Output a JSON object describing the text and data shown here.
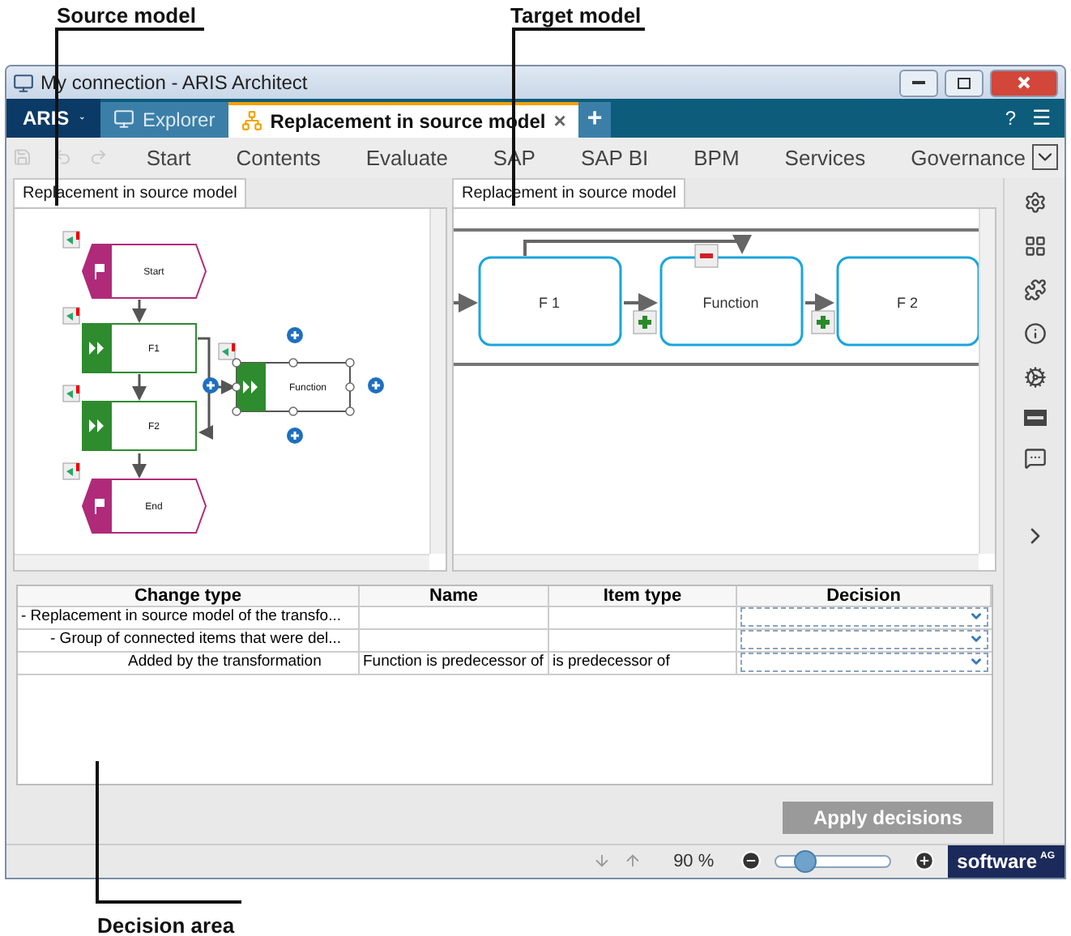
{
  "callouts": [
    {
      "label": "Source model"
    },
    {
      "label": "Target model"
    },
    {
      "label": "Decision area"
    }
  ],
  "window": {
    "title": "My connection - ARIS Architect"
  },
  "app_bar": {
    "menu": "ARIS",
    "tabs": [
      {
        "label": "Explorer",
        "selected": false
      },
      {
        "label": "Replacement in source model",
        "selected": true,
        "close": "×"
      }
    ],
    "new_tab": "+",
    "help": "?",
    "menu_icon": "☰"
  },
  "ribbon": {
    "tabs": [
      "Start",
      "Contents",
      "Evaluate",
      "SAP",
      "SAP BI",
      "BPM",
      "Services",
      "Governance"
    ]
  },
  "source_panel": {
    "tab": "Replacement in source model",
    "nodes": [
      {
        "kind": "event",
        "label": "Start"
      },
      {
        "kind": "function",
        "label": "F1",
        "selected": false
      },
      {
        "kind": "function",
        "label": "F2",
        "selected": false
      },
      {
        "kind": "event",
        "label": "End"
      },
      {
        "kind": "function",
        "label": "Function",
        "selected": true
      }
    ]
  },
  "target_panel": {
    "tab": "Replacement in source model",
    "nodes": [
      {
        "label": "F 1"
      },
      {
        "label": "Function"
      },
      {
        "label": "F 2"
      }
    ]
  },
  "decision_table": {
    "columns": [
      "Change type",
      "Name",
      "Item type",
      "Decision"
    ],
    "rows": [
      {
        "change_type": "- Replacement in source model of the transfo...",
        "children": [
          {
            "change_type": "- Group of connected items that were del...",
            "children": [
              {
                "change_type": "Added by the transformation",
                "name": "Function is predecessor of",
                "item_type": "is predecessor of"
              }
            ]
          }
        ]
      }
    ]
  },
  "apply_button": {
    "label": "Apply decisions",
    "disabled": true
  },
  "status_bar": {
    "zoom": "90 %",
    "level": 0.25,
    "logo": "software",
    "logo_suffix": "AG"
  }
}
